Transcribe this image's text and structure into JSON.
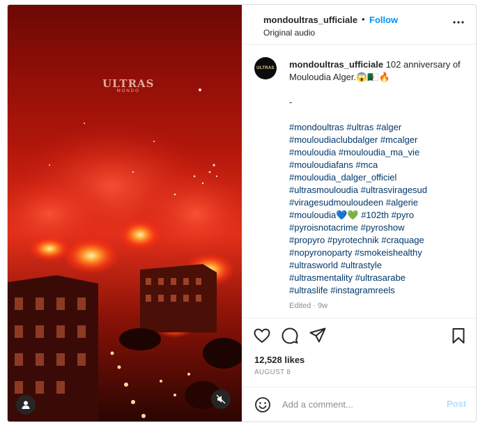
{
  "post": {
    "username": "mondoultras_ufficiale",
    "separator": "•",
    "follow_label": "Follow",
    "audio_label": "Original audio",
    "avatar_text": "ULTRAS",
    "media": {
      "watermark_main": "ULTRAS",
      "watermark_sub": "MONDO",
      "user_tag_icon": "user-silhouette-icon",
      "mute_icon": "speaker-muted-icon"
    }
  },
  "caption": {
    "username": "mondoultras_ufficiale",
    "text": "102 anniversary of Mouloudia Alger.😱🇩🇿🔥",
    "dash": "-",
    "hashtag_lines": [
      "#mondoultras #ultras #alger",
      "#mouloudiaclubdalger #mcalger",
      "#mouloudia #mouloudia_ma_vie",
      "#mouloudiafans #mca",
      "#mouloudia_dalger_officiel",
      "#ultrasmouloudia #ultrasviragesud",
      "#viragesudmouloudeen #algerie",
      "#mouloudia💙💚 #102th #pyro",
      "#pyroisnotacrime #pyroshow",
      "#propyro #pyrotechnik #craquage",
      "#nopyronoparty #smokeishealthy",
      "#ultrasworld #ultrastyle",
      "#ultrasmentality #ultrasarabe",
      "#ultraslife #instagramreels"
    ],
    "edited": "Edited · 9w"
  },
  "actions": {
    "like_icon": "heart-icon",
    "comment_icon": "comment-bubble-icon",
    "share_icon": "paper-plane-icon",
    "save_icon": "bookmark-icon",
    "likes": "12,528 likes",
    "date": "AUGUST 8"
  },
  "comment": {
    "emoji_icon": "emoji-smile-icon",
    "placeholder": "Add a comment...",
    "post_label": "Post"
  },
  "colors": {
    "accent": "#0095f6",
    "hashtag": "#00376b",
    "post_disabled": "#b2dffc",
    "muted_text": "#8e8e8e",
    "border": "#dbdbdb"
  }
}
